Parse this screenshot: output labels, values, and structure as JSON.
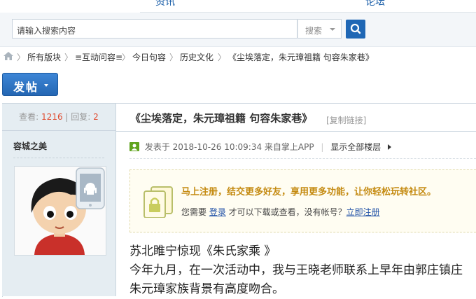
{
  "topnav": {
    "tab_left": "资讯",
    "tab_right": "论坛"
  },
  "search": {
    "placeholder": "请输入搜索内容",
    "type_label": "搜索"
  },
  "breadcrumb": {
    "items": [
      "所有版块",
      "≡互动问容≡",
      "今日句容",
      "历史文化",
      "《尘埃落定，朱元璋祖籍 句容朱家巷》"
    ],
    "separator": "〉"
  },
  "post_button": {
    "label": "发帖"
  },
  "stats": {
    "views_label": "查看:",
    "views": "1216",
    "divider": "|",
    "replies_label": "回复:",
    "replies": "2"
  },
  "author": {
    "name": "容城之美"
  },
  "thread": {
    "title": "《尘埃落定，朱元璋祖籍 句容朱家巷》",
    "copy_link": "[复制链接]",
    "meta_posted": "发表于 2018-10-26 10:09:34 来自掌上APP",
    "meta_divider": "|",
    "show_all": "显示全部楼层"
  },
  "notice": {
    "headline": "马上注册，结交更多好友，享用更多功能，让你轻松玩转社区。",
    "text_before": "您需要 ",
    "login": "登录",
    "text_middle": " 才可以下载或查看，没有帐号？",
    "register": "立即注册"
  },
  "content": {
    "lines": [
      "苏北睢宁惊现《朱氏家乘 》",
      "今年九月，在一次活动中，我与王晓老师联系上早年由郭庄镇庄",
      "朱元璋家族背景有高度吻合。"
    ]
  },
  "colors": {
    "brand_blue": "#1f67b5",
    "accent_red": "#e04a2e",
    "notice_orange": "#c48a10"
  }
}
